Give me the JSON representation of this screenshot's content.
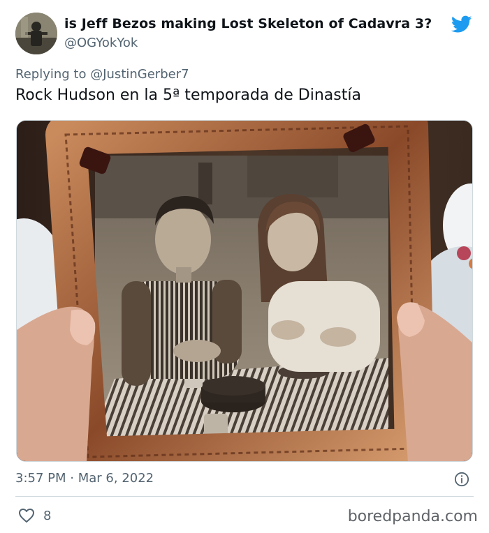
{
  "tweet": {
    "display_name": "is Jeff Bezos making Lost Skeleton of Cadavra 3?",
    "handle": "@OGYokYok",
    "replying_prefix": "Replying to",
    "replying_to": "@JustinGerber7",
    "text": "Rock Hudson en la 5ª temporada de Dinastía",
    "time": "3:57 PM",
    "separator": "·",
    "date": "Mar 6, 2022",
    "likes": "8"
  },
  "icons": {
    "platform": "twitter-bird-icon",
    "info": "info-icon",
    "like": "heart-icon"
  },
  "colors": {
    "brand_blue": "#1d9bf0",
    "text_primary": "#0f1419",
    "text_secondary": "#536471",
    "divider": "#cfd9de",
    "watermark": "#5f6368"
  },
  "watermark": "boredpanda.com"
}
